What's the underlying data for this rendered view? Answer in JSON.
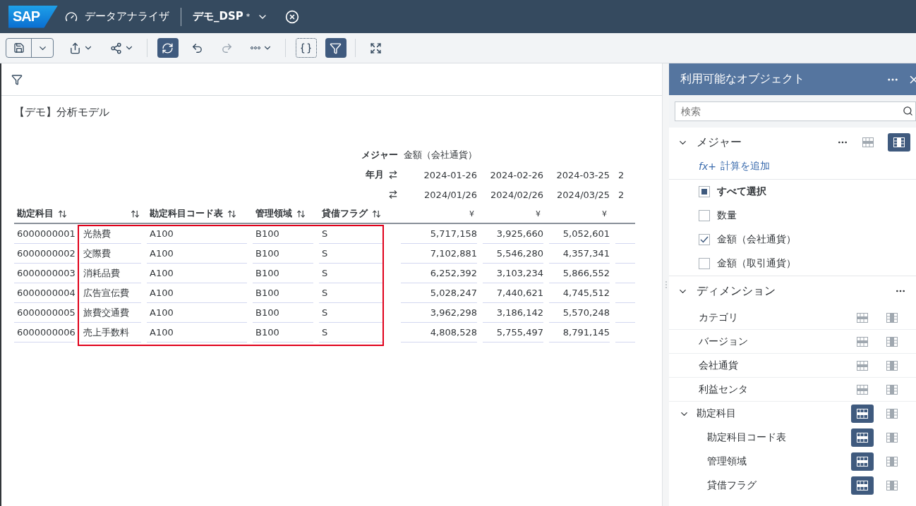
{
  "header": {
    "logo": "SAP",
    "app": "データアナライザ",
    "document": "デモ_DSP",
    "modified": true,
    "modified_mark": "*"
  },
  "toolbar": [
    {
      "kind": "save",
      "selected": false,
      "disabled": false
    },
    {
      "kind": "export",
      "selected": false,
      "disabled": false
    },
    {
      "kind": "share",
      "selected": false,
      "disabled": false
    },
    {
      "kind": "refresh",
      "selected": true,
      "disabled": false
    },
    {
      "kind": "undo",
      "selected": false,
      "disabled": false
    },
    {
      "kind": "redo",
      "selected": false,
      "disabled": true
    },
    {
      "kind": "more",
      "selected": false,
      "disabled": false
    },
    {
      "kind": "script",
      "selected": false,
      "disabled": false
    },
    {
      "kind": "filter",
      "selected": true,
      "disabled": false
    },
    {
      "kind": "fullscreen",
      "selected": false,
      "disabled": false
    }
  ],
  "report": {
    "title": "【デモ】分析モデル",
    "measure_label": "メジャー",
    "measure": "金額（会社通貨）",
    "period_label": "年月",
    "columns": [
      {
        "label": "勘定科目",
        "highlighted": false
      },
      {
        "highlighted": true
      },
      {
        "label": "勘定科目コード表",
        "highlighted": true
      },
      {
        "label": "管理領域",
        "highlighted": true
      },
      {
        "label": "貸借フラグ",
        "highlighted": true
      }
    ],
    "periods": [
      {
        "date": "2024-01-26",
        "label": "2024/01/26",
        "currency": "¥"
      },
      {
        "date": "2024-02-26",
        "label": "2024/02/26",
        "currency": "¥"
      },
      {
        "date": "2024-03-25",
        "label": "2024/03/25",
        "currency": "¥"
      },
      {
        "date": "2",
        "label": "2"
      }
    ],
    "rows": [
      {
        "cells": [
          "6000000001",
          "光熱費",
          "A100",
          "B100",
          "S"
        ],
        "values": [
          "5,717,158",
          "3,925,660",
          "5,052,601"
        ]
      },
      {
        "cells": [
          "6000000002",
          "交際費",
          "A100",
          "B100",
          "S"
        ],
        "values": [
          "7,102,881",
          "5,546,280",
          "4,357,341"
        ]
      },
      {
        "cells": [
          "6000000003",
          "消耗品費",
          "A100",
          "B100",
          "S"
        ],
        "values": [
          "6,252,392",
          "3,103,234",
          "5,866,552"
        ]
      },
      {
        "cells": [
          "6000000004",
          "広告宣伝費",
          "A100",
          "B100",
          "S"
        ],
        "values": [
          "5,028,247",
          "7,440,621",
          "4,745,512"
        ]
      },
      {
        "cells": [
          "6000000005",
          "旅費交通費",
          "A100",
          "B100",
          "S"
        ],
        "values": [
          "3,962,298",
          "3,186,142",
          "5,570,248"
        ]
      },
      {
        "cells": [
          "6000000006",
          "売上手数料",
          "A100",
          "B100",
          "S"
        ],
        "values": [
          "4,808,528",
          "5,755,497",
          "8,791,145"
        ]
      }
    ]
  },
  "panel": {
    "title": "利用可能なオブジェクト",
    "search": {
      "placeholder": "検索"
    },
    "measures": {
      "label": "メジャー",
      "expanded": true,
      "on_rows": false,
      "on_columns": true,
      "add_calc_icon": "fx+",
      "add_calc": "計算を追加",
      "items": [
        {
          "label": "すべて選択",
          "kind": "all",
          "checked": true
        },
        {
          "label": "数量",
          "kind": "item",
          "checked": false
        },
        {
          "label": "金額（会社通貨）",
          "kind": "item",
          "checked": true
        },
        {
          "label": "金額（取引通貨）",
          "kind": "item",
          "checked": false
        }
      ]
    },
    "dimensions": {
      "label": "ディメンション",
      "expanded": true,
      "items": [
        {
          "label": "カテゴリ",
          "on_rows": false,
          "on_columns": false
        },
        {
          "label": "バージョン",
          "on_rows": false,
          "on_columns": false
        },
        {
          "label": "会社通貨",
          "on_rows": false,
          "on_columns": false
        },
        {
          "label": "利益センタ",
          "on_rows": false,
          "on_columns": false
        },
        {
          "label": "勘定科目",
          "on_rows": true,
          "on_columns": false,
          "expanded": true,
          "children": [
            {
              "label": "勘定科目コード表",
              "on_rows": true,
              "on_columns": false
            },
            {
              "label": "管理領域",
              "on_rows": true,
              "on_columns": false
            },
            {
              "label": "貸借フラグ",
              "on_rows": true,
              "on_columns": false
            }
          ]
        }
      ]
    }
  }
}
